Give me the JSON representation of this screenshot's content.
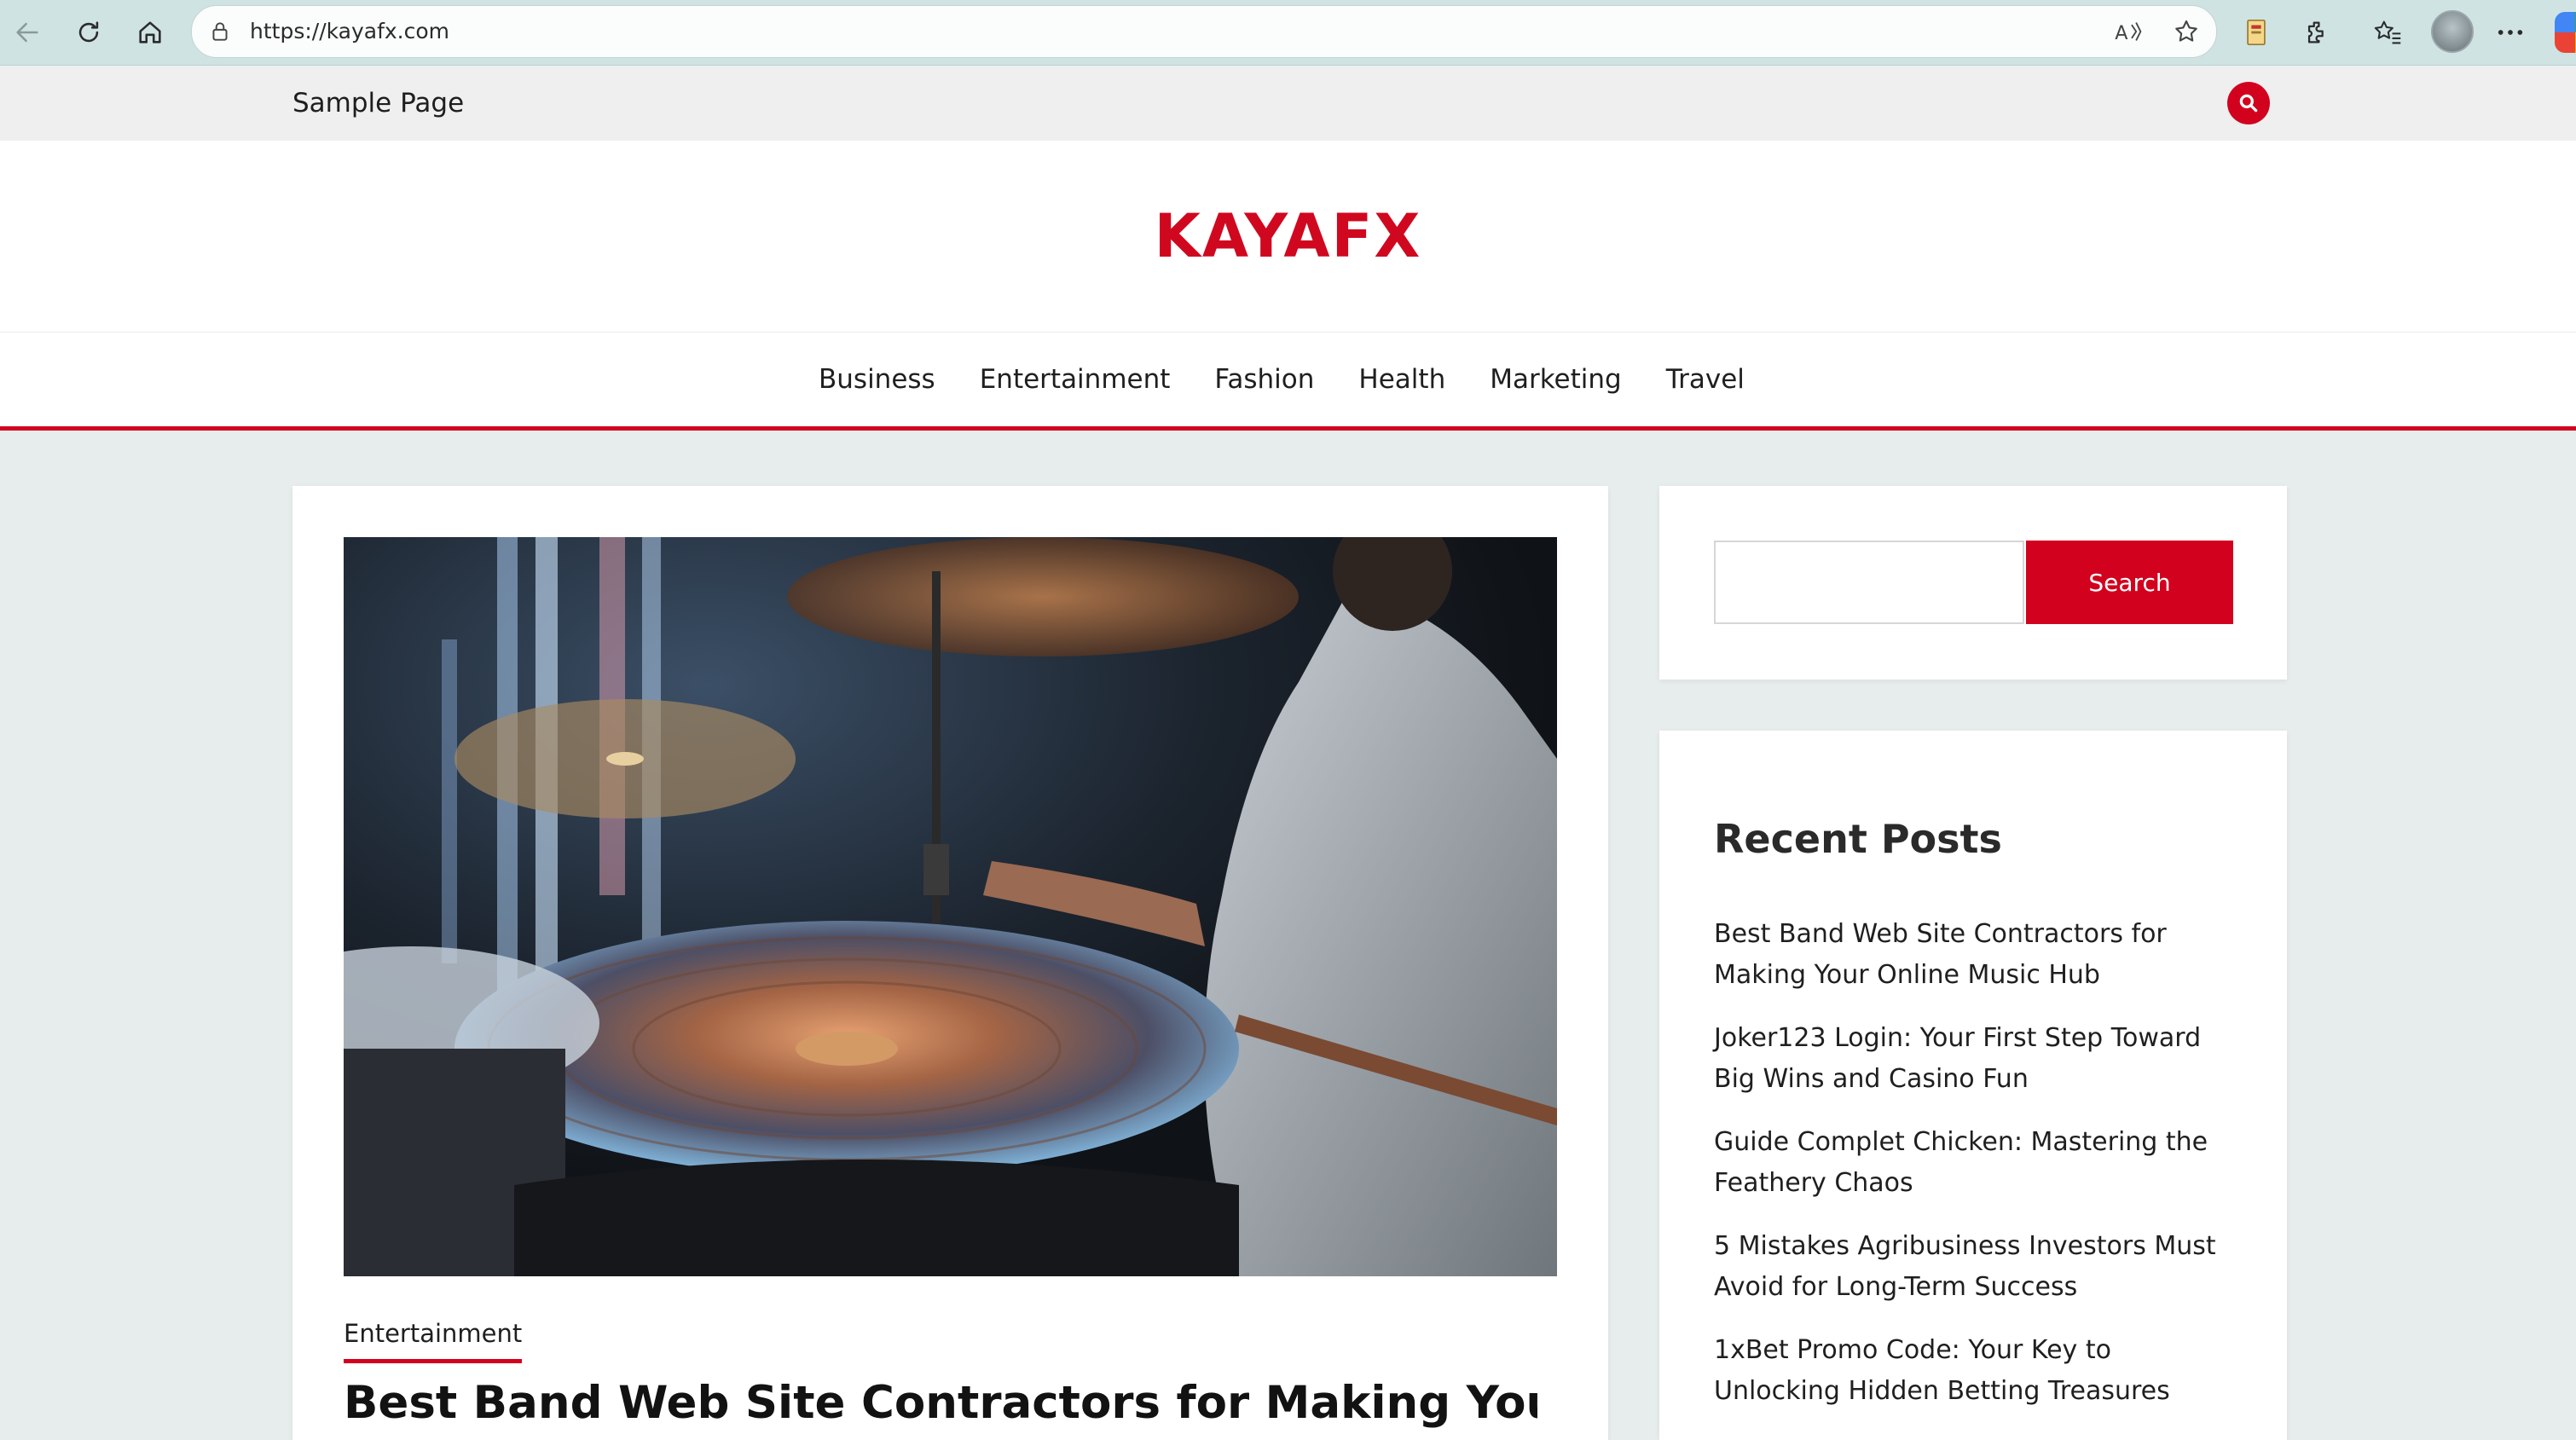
{
  "browser": {
    "url": "https://kayafx.com",
    "icons": [
      "back-icon",
      "refresh-icon",
      "home-icon",
      "lock-icon",
      "read-aloud-icon",
      "favorite-star-icon",
      "collections-icon",
      "extensions-icon",
      "favorites-icon",
      "profile-avatar",
      "more-icon",
      "copilot-icon"
    ]
  },
  "topbar": {
    "sample_page": "Sample Page"
  },
  "site": {
    "logo": "KAYAFX",
    "accent": "#d2021e"
  },
  "menu": {
    "items": [
      "Business",
      "Entertainment",
      "Fashion",
      "Health",
      "Marketing",
      "Travel"
    ]
  },
  "post": {
    "category": "Entertainment",
    "title": "Best Band Web Site Contractors for Making Your Online Music Hub"
  },
  "sidebar": {
    "search_button": "Search",
    "recent_title": "Recent Posts",
    "recent": [
      "Best Band Web Site Contractors for Making Your Online Music Hub",
      "Joker123 Login: Your First Step Toward Big Wins and Casino Fun",
      "Guide Complet Chicken: Mastering the Feathery Chaos",
      "5 Mistakes Agribusiness Investors Must Avoid for Long-Term Success",
      "1xBet Promo Code: Your Key to Unlocking Hidden Betting Treasures"
    ]
  }
}
